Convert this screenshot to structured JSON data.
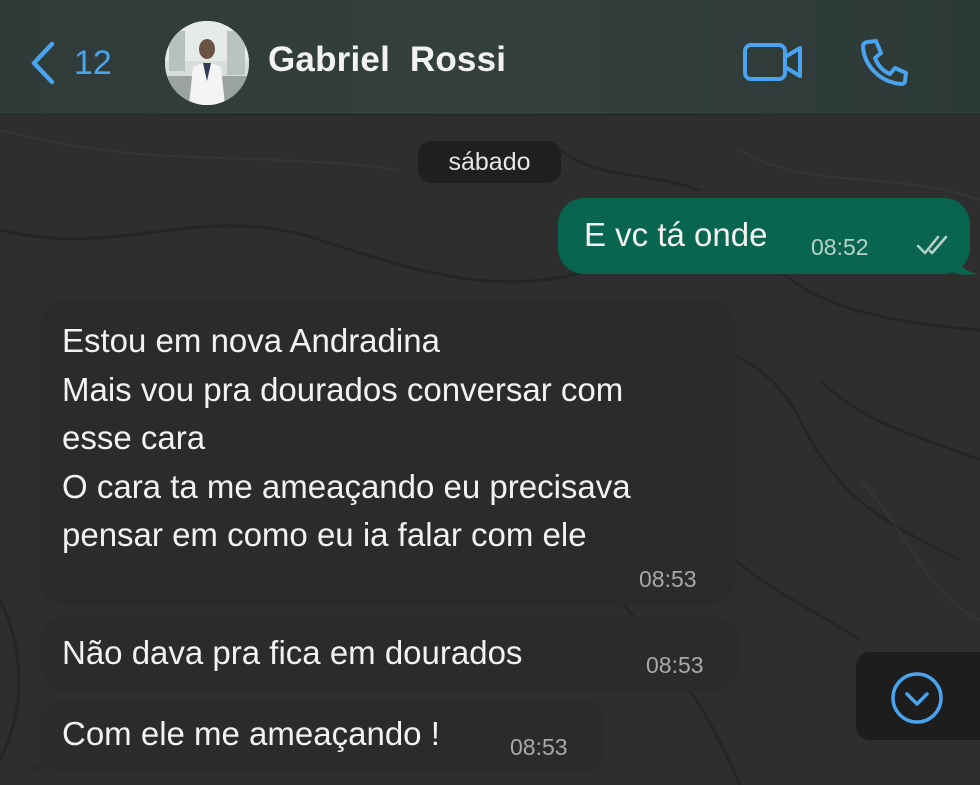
{
  "header": {
    "back_count": "12",
    "contact_name": "Gabriel  Rossi",
    "accent_color": "#4aa3ef"
  },
  "icons": {
    "back": "chevron-left-icon",
    "video": "video-camera-icon",
    "call": "phone-icon",
    "read_receipt": "double-check-icon",
    "scroll_down": "chevron-down-circle-icon"
  },
  "chat": {
    "date_separator": "sábado",
    "messages": [
      {
        "direction": "outgoing",
        "text": "E vc tá onde",
        "time": "08:52"
      },
      {
        "direction": "incoming",
        "text": "Estou em nova Andradina\nMais vou pra dourados conversar com\nesse cara\nO cara ta me ameaçando eu precisava\npensar em como eu ia falar com ele",
        "time": "08:53"
      },
      {
        "direction": "incoming",
        "text": "Não dava pra fica em dourados",
        "time": "08:53"
      },
      {
        "direction": "incoming",
        "text": "Com ele me ameaçando !",
        "time": "08:53"
      }
    ],
    "outgoing_color": "#0a6550",
    "incoming_color": "#2b2a2d"
  }
}
